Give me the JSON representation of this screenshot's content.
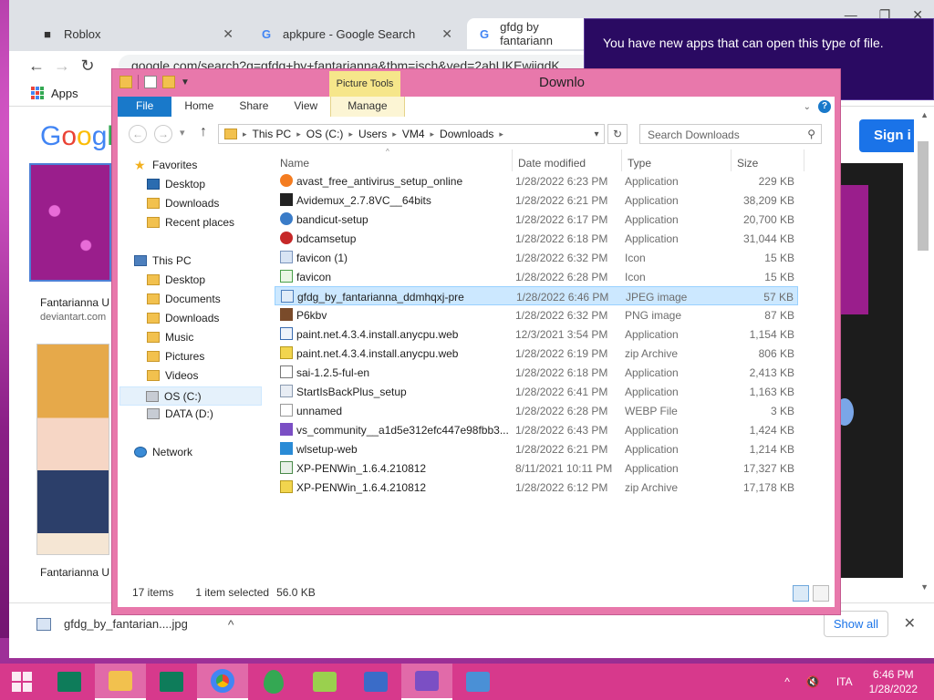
{
  "chrome": {
    "tabs": [
      {
        "label": "Roblox",
        "icon": "roblox-icon"
      },
      {
        "label": "apkpure - Google Search",
        "icon": "google-icon"
      },
      {
        "label": "gfdg by fantariann",
        "icon": "google-icon"
      }
    ],
    "url": "google.com/search?q=gfdg+by+fantarianna&tbm=isch&ved=2ahUKEwiiqdK",
    "bookmarks": {
      "apps_label": "Apps"
    },
    "google": {
      "logo": "Googl",
      "sign_in": "Sign i",
      "result1_caption": "Fantarianna U",
      "result1_source": "deviantart.com",
      "result2_caption": "Fantarianna U"
    },
    "download_bar": {
      "file": "gfdg_by_fantarian....jpg",
      "show_all": "Show all"
    }
  },
  "toast": {
    "message": "You have new apps that can open this type of file."
  },
  "explorer": {
    "picture_tools": "Picture Tools",
    "title": "Downlo",
    "ribbon_tabs": {
      "file": "File",
      "home": "Home",
      "share": "Share",
      "view": "View",
      "manage": "Manage"
    },
    "address": [
      "This PC",
      "OS (C:)",
      "Users",
      "VM4",
      "Downloads"
    ],
    "search_placeholder": "Search Downloads",
    "nav": {
      "favorites": "Favorites",
      "fav_items": [
        "Desktop",
        "Downloads",
        "Recent places"
      ],
      "this_pc": "This PC",
      "pc_items": [
        "Desktop",
        "Documents",
        "Downloads",
        "Music",
        "Pictures",
        "Videos",
        "OS (C:)",
        "DATA (D:)"
      ],
      "network": "Network"
    },
    "columns": {
      "name": "Name",
      "date": "Date modified",
      "type": "Type",
      "size": "Size"
    },
    "files": [
      {
        "name": "avast_free_antivirus_setup_online",
        "date": "1/28/2022 6:23 PM",
        "type": "Application",
        "size": "229 KB",
        "icon": "avast-icon"
      },
      {
        "name": "Avidemux_2.7.8VC__64bits",
        "date": "1/28/2022 6:21 PM",
        "type": "Application",
        "size": "38,209 KB",
        "icon": "avidemux-icon"
      },
      {
        "name": "bandicut-setup",
        "date": "1/28/2022 6:17 PM",
        "type": "Application",
        "size": "20,700 KB",
        "icon": "bandicut-icon"
      },
      {
        "name": "bdcamsetup",
        "date": "1/28/2022 6:18 PM",
        "type": "Application",
        "size": "31,044 KB",
        "icon": "bandicam-icon"
      },
      {
        "name": "favicon (1)",
        "date": "1/28/2022 6:32 PM",
        "type": "Icon",
        "size": "15 KB",
        "icon": "ico-file-icon"
      },
      {
        "name": "favicon",
        "date": "1/28/2022 6:28 PM",
        "type": "Icon",
        "size": "15 KB",
        "icon": "ico-file-icon"
      },
      {
        "name": "gfdg_by_fantarianna_ddmhqxj-pre",
        "date": "1/28/2022 6:46 PM",
        "type": "JPEG image",
        "size": "57 KB",
        "icon": "jpeg-file-icon"
      },
      {
        "name": "P6kbv",
        "date": "1/28/2022 6:32 PM",
        "type": "PNG image",
        "size": "87 KB",
        "icon": "png-file-icon"
      },
      {
        "name": "paint.net.4.3.4.install.anycpu.web",
        "date": "12/3/2021 3:54 PM",
        "type": "Application",
        "size": "1,154 KB",
        "icon": "paintnet-icon"
      },
      {
        "name": "paint.net.4.3.4.install.anycpu.web",
        "date": "1/28/2022 6:19 PM",
        "type": "zip Archive",
        "size": "806 KB",
        "icon": "zip-icon"
      },
      {
        "name": "sai-1.2.5-ful-en",
        "date": "1/28/2022 6:18 PM",
        "type": "Application",
        "size": "2,413 KB",
        "icon": "sai-icon"
      },
      {
        "name": "StartIsBackPlus_setup",
        "date": "1/28/2022 6:41 PM",
        "type": "Application",
        "size": "1,163 KB",
        "icon": "startisback-icon"
      },
      {
        "name": "unnamed",
        "date": "1/28/2022 6:28 PM",
        "type": "WEBP File",
        "size": "3 KB",
        "icon": "webp-file-icon"
      },
      {
        "name": "vs_community__a1d5e312efc447e98fbb3...",
        "date": "1/28/2022 6:43 PM",
        "type": "Application",
        "size": "1,424 KB",
        "icon": "visual-studio-icon"
      },
      {
        "name": "wlsetup-web",
        "date": "1/28/2022 6:21 PM",
        "type": "Application",
        "size": "1,214 KB",
        "icon": "windows-live-icon"
      },
      {
        "name": "XP-PENWin_1.6.4.210812",
        "date": "8/11/2021 10:11 PM",
        "type": "Application",
        "size": "17,327 KB",
        "icon": "xppen-icon"
      },
      {
        "name": "XP-PENWin_1.6.4.210812",
        "date": "1/28/2022 6:12 PM",
        "type": "zip Archive",
        "size": "17,178 KB",
        "icon": "zip-icon"
      }
    ],
    "selected_index": 6,
    "status": {
      "items": "17 items",
      "selected": "1 item selected",
      "size": "56.0 KB"
    }
  },
  "taskbar": {
    "lang": "ITA",
    "time": "6:46 PM",
    "date": "1/28/2022"
  },
  "colors": {
    "explorer_frame": "#e878ab",
    "taskbar": "#d7398c",
    "toast_bg": "#2a0a62",
    "ribbon_file": "#1979ca"
  }
}
